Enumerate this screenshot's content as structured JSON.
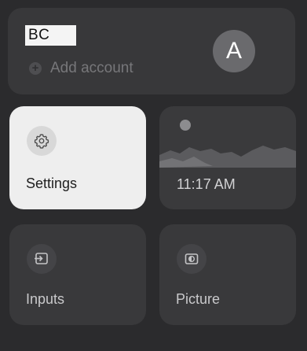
{
  "account": {
    "name": "BC",
    "add_account_label": "Add account",
    "avatar_letter": "A"
  },
  "tiles": {
    "settings_label": "Settings",
    "clock_time": "11:17 AM",
    "inputs_label": "Inputs",
    "picture_label": "Picture"
  },
  "icons": {
    "add": "plus-icon",
    "settings": "gear-icon",
    "inputs": "input-icon",
    "picture": "picture-mode-icon",
    "ambient": "landscape-icon"
  },
  "colors": {
    "background": "#2b2b2d",
    "card": "#39393b",
    "selected_tile": "#eeeeee"
  }
}
